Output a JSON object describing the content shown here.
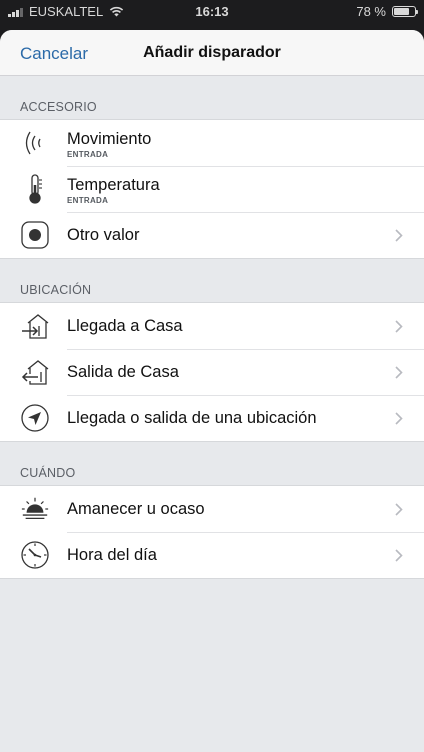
{
  "status_bar": {
    "carrier": "EUSKALTEL",
    "time": "16:13",
    "battery": "78 %",
    "battery_level": 0.78
  },
  "nav": {
    "cancel_label": "Cancelar",
    "title": "Añadir disparador"
  },
  "sections": {
    "accessory": {
      "header": "ACCESORIO",
      "items": [
        {
          "label": "Movimiento",
          "sub": "ENTRADA",
          "icon": "motion-sensor-icon"
        },
        {
          "label": "Temperatura",
          "sub": "ENTRADA",
          "icon": "thermometer-icon"
        },
        {
          "label": "Otro valor",
          "icon": "record-button-icon"
        }
      ]
    },
    "location": {
      "header": "UBICACIÓN",
      "items": [
        {
          "label": "Llegada a Casa",
          "icon": "arrive-home-icon"
        },
        {
          "label": "Salida de Casa",
          "icon": "leave-home-icon"
        },
        {
          "label": "Llegada o salida de una ubicación",
          "icon": "location-arrow-icon"
        }
      ]
    },
    "when": {
      "header": "CUÁNDO",
      "items": [
        {
          "label": "Amanecer u ocaso",
          "icon": "sunrise-icon"
        },
        {
          "label": "Hora del día",
          "icon": "clock-icon"
        }
      ]
    }
  }
}
